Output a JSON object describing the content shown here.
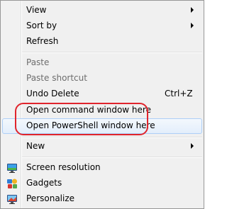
{
  "menu": {
    "group1": [
      {
        "label": "View",
        "submenu": true
      },
      {
        "label": "Sort by",
        "submenu": true
      },
      {
        "label": "Refresh",
        "submenu": false
      }
    ],
    "group2": [
      {
        "label": "Paste",
        "disabled": true
      },
      {
        "label": "Paste shortcut",
        "disabled": true
      },
      {
        "label": "Undo Delete",
        "shortcut": "Ctrl+Z"
      },
      {
        "label": "Open command window here"
      },
      {
        "label": "Open PowerShell window here",
        "hovered": true
      }
    ],
    "group3": [
      {
        "label": "New",
        "submenu": true
      }
    ],
    "group4": [
      {
        "label": "Screen resolution",
        "icon": "monitor-icon"
      },
      {
        "label": "Gadgets",
        "icon": "gadgets-icon"
      },
      {
        "label": "Personalize",
        "icon": "personalize-icon"
      }
    ]
  },
  "annotation": {
    "color": "#e0242c"
  },
  "colors": {
    "hover_border": "#aecff7",
    "disabled_text": "#6d6d6d"
  }
}
